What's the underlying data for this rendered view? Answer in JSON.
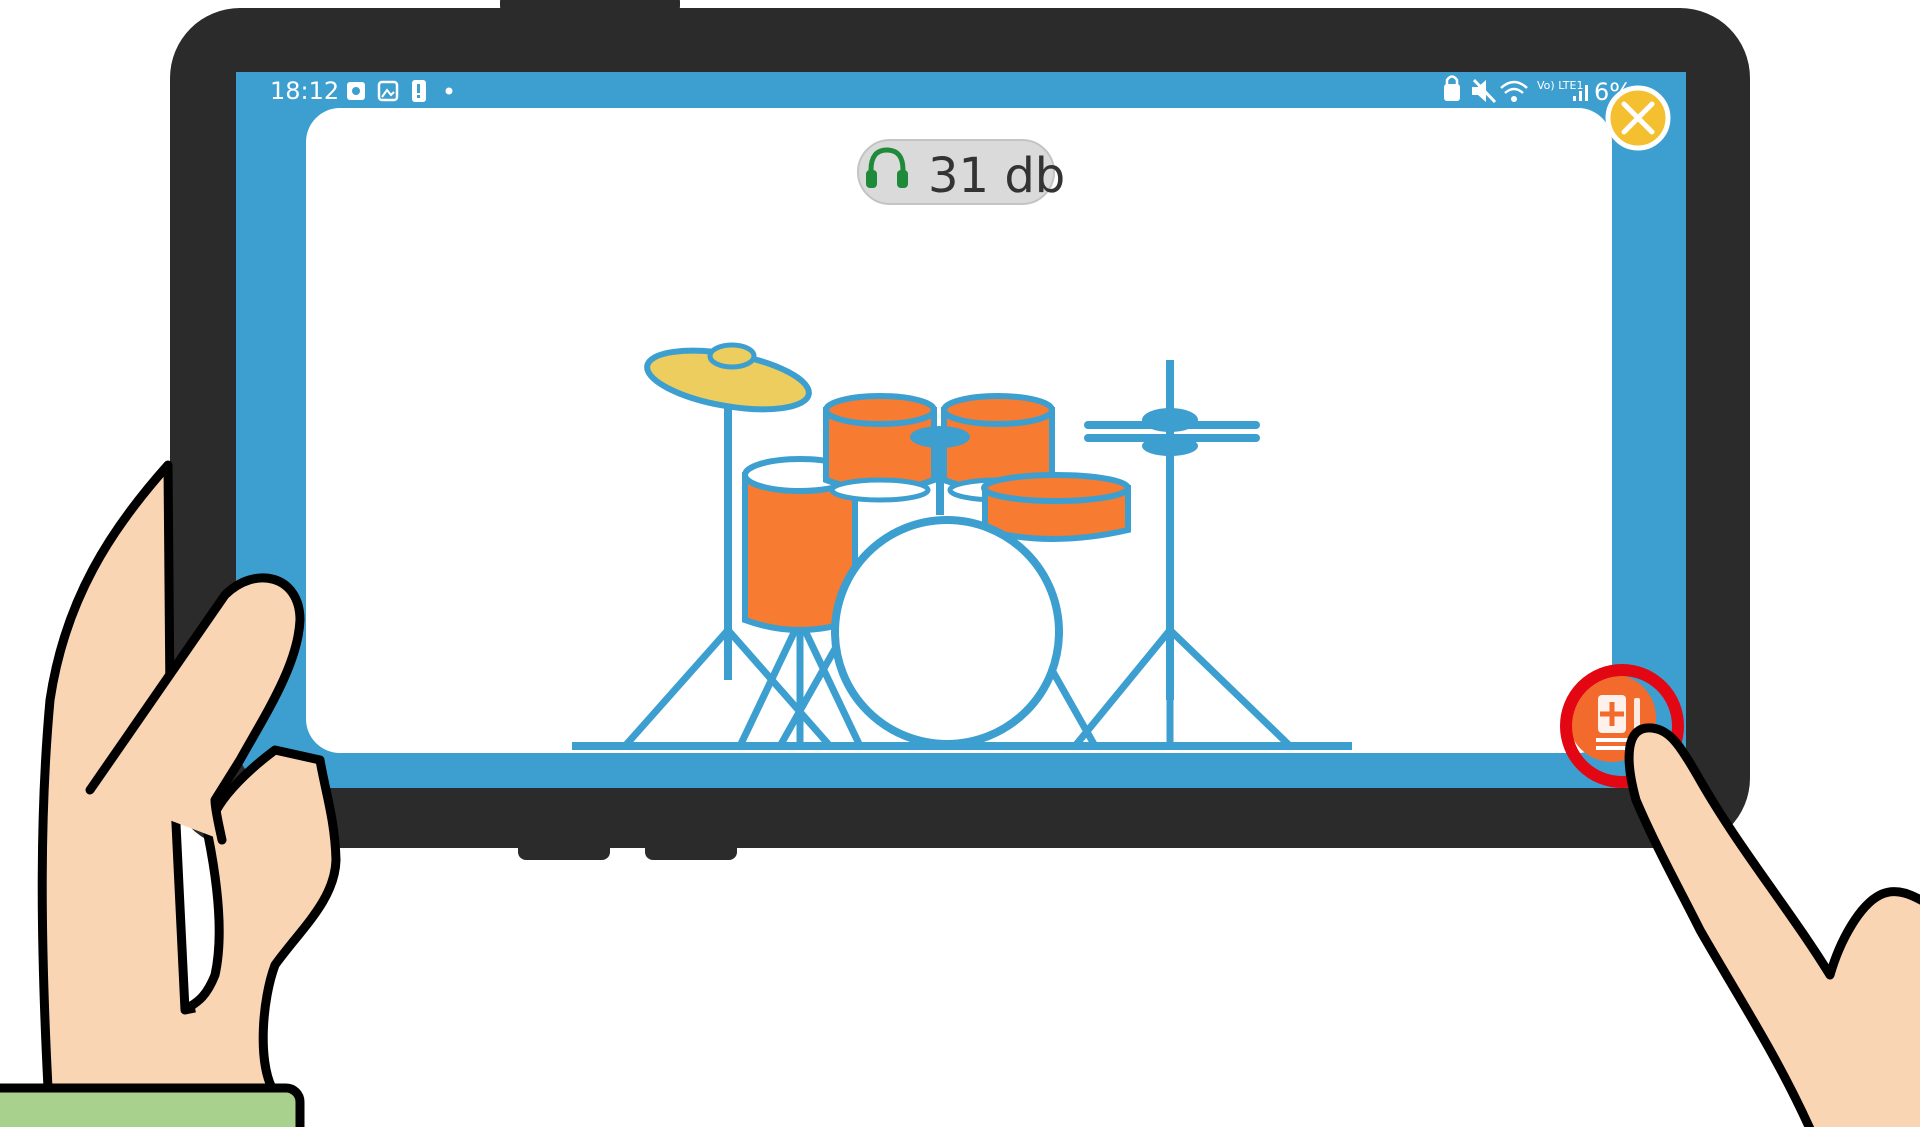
{
  "status_bar": {
    "time": "18:12",
    "battery": "6%",
    "network_label": "Vo) LTE1",
    "left_icons": [
      "photo-icon",
      "gallery-icon",
      "battery-alert-icon",
      "dot-icon"
    ],
    "right_icons": [
      "lock-icon",
      "mute-icon",
      "wifi-icon",
      "volte-icon",
      "signal-icon"
    ]
  },
  "sound_meter": {
    "value": "31 db",
    "icon": "headphones-icon"
  },
  "illustration": "drum-kit",
  "buttons": {
    "close": {
      "icon": "close-icon"
    },
    "add_to_list": {
      "icon": "add-to-list-icon"
    }
  },
  "colors": {
    "device_frame": "#2b2b2b",
    "screen_border": "#3d9fd0",
    "drum_blue": "#3d9fd0",
    "drum_orange": "#f77b30",
    "cymbal_yellow": "#eccd5e",
    "close_button": "#f4c030",
    "action_button": "#f26b2c",
    "tap_highlight": "#e30613",
    "skin": "#fad5b4",
    "sleeve": "#a9d18e"
  }
}
